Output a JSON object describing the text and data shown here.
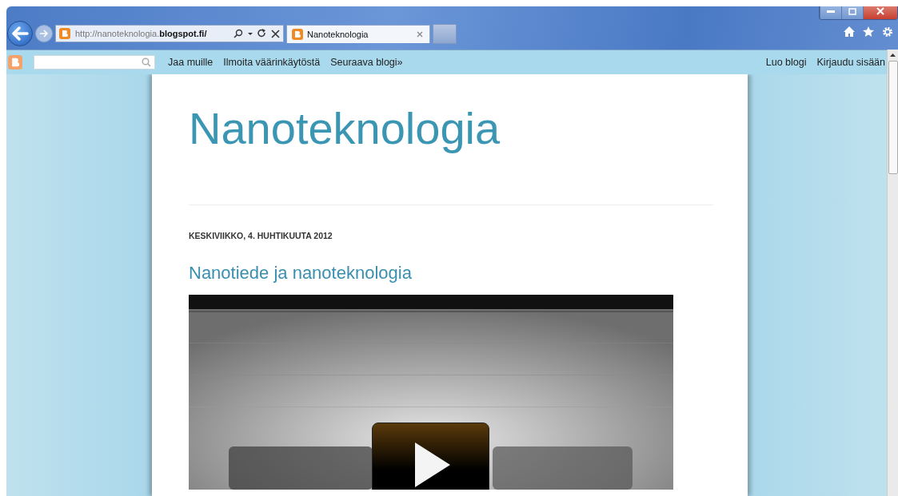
{
  "browser": {
    "address": "http://nanoteknologia.**blogspot.fi/**",
    "tabs": [
      {
        "title": "Nanoteknologia",
        "selected": true
      }
    ]
  },
  "navbar": {
    "links": [
      "Jaa muille",
      "Ilmoita väärinkäytöstä",
      "Seuraava blogi»"
    ],
    "right_links": [
      "Luo blogi",
      "Kirjaudu sisään"
    ]
  },
  "blog": {
    "title": "Nanoteknologia",
    "date": "KESKIVIIKKO, 4. HUHTIKUUTA 2012",
    "post_title": "Nanotiede ja nanoteknologia"
  }
}
